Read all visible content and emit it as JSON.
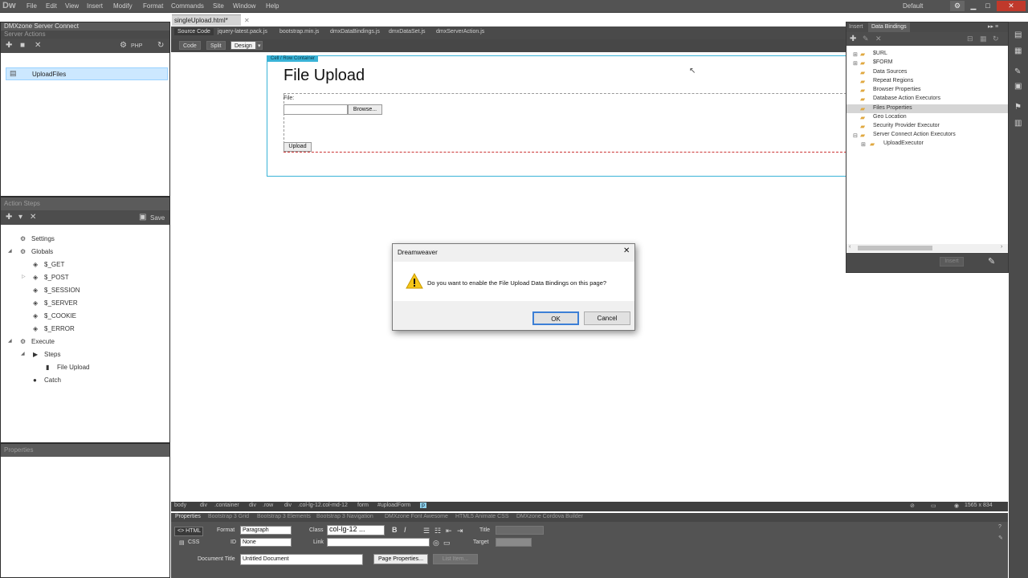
{
  "app": {
    "logo": "Dw",
    "menu": [
      "File",
      "Edit",
      "View",
      "Insert",
      "Modify",
      "Format",
      "Commands",
      "Site",
      "Window",
      "Help"
    ],
    "workspace": "Default"
  },
  "left": {
    "server_connect_title": "DMXzone Server Connect",
    "server_actions_title": "Server Actions",
    "language": "PHP",
    "server_action_item": "UploadFiles",
    "action_steps_title": "Action Steps",
    "save_label": "Save",
    "tree": [
      "Settings",
      "Globals",
      "$_GET",
      "$_POST",
      "$_SESSION",
      "$_SERVER",
      "$_COOKIE",
      "$_ERROR",
      "Execute",
      "Steps",
      "File Upload",
      "Catch"
    ],
    "properties_title": "Properties"
  },
  "doc": {
    "tab": "singleUpload.html*",
    "related_files": [
      "Source Code",
      "jquery-latest.pack.js",
      "bootstrap.min.js",
      "dmxDataBindings.js",
      "dmxDataSet.js",
      "dmxServerAction.js"
    ],
    "modes": [
      "Code",
      "Split",
      "Design"
    ],
    "container_label": "Cell / Row Container",
    "heading": "File Upload",
    "file_label": "File:",
    "browse_label": "Browse...",
    "upload_label": "Upload"
  },
  "tagbar": [
    "body",
    "div",
    ".container",
    "div",
    ".row",
    "div",
    ".col-lg-12.col-md-12",
    "form",
    "#uploadForm",
    "p"
  ],
  "tagbar_right": "1565 x 834",
  "props": {
    "tabs": [
      "Properties",
      "Bootstrap 3 Grid",
      "Bootstrap 3 Elements",
      "Bootstrap 3 Navigation",
      "DMXzone Font Awesome",
      "HTML5 Animate CSS",
      "DMXzone Cordova Builder"
    ],
    "html_label": "HTML",
    "css_label": "CSS",
    "format_label": "Format",
    "format_value": "Paragraph",
    "id_label": "ID",
    "id_value": "None",
    "class_label": "Class",
    "class_value": "col-lg-12 ...",
    "link_label": "Link",
    "title_label": "Title",
    "target_label": "Target",
    "doc_title_label": "Document Title",
    "doc_title_value": "Untitled Document",
    "page_props_label": "Page Properties...",
    "list_item_label": "List Item..."
  },
  "bindings": {
    "tabs": [
      "Insert",
      "Data Bindings"
    ],
    "items": [
      "$URL",
      "$FORM",
      "Data Sources",
      "Repeat Regions",
      "Browser Properties",
      "Database Action Executors",
      "Files Properties",
      "Geo Location",
      "Security Provider Executor",
      "Server Connect Action Executors",
      "UploadExecutor"
    ],
    "insert_label": "Insert"
  },
  "dialog": {
    "title": "Dreamweaver",
    "message": "Do you want to enable the File Upload Data Bindings on this page?",
    "ok": "OK",
    "cancel": "Cancel"
  }
}
